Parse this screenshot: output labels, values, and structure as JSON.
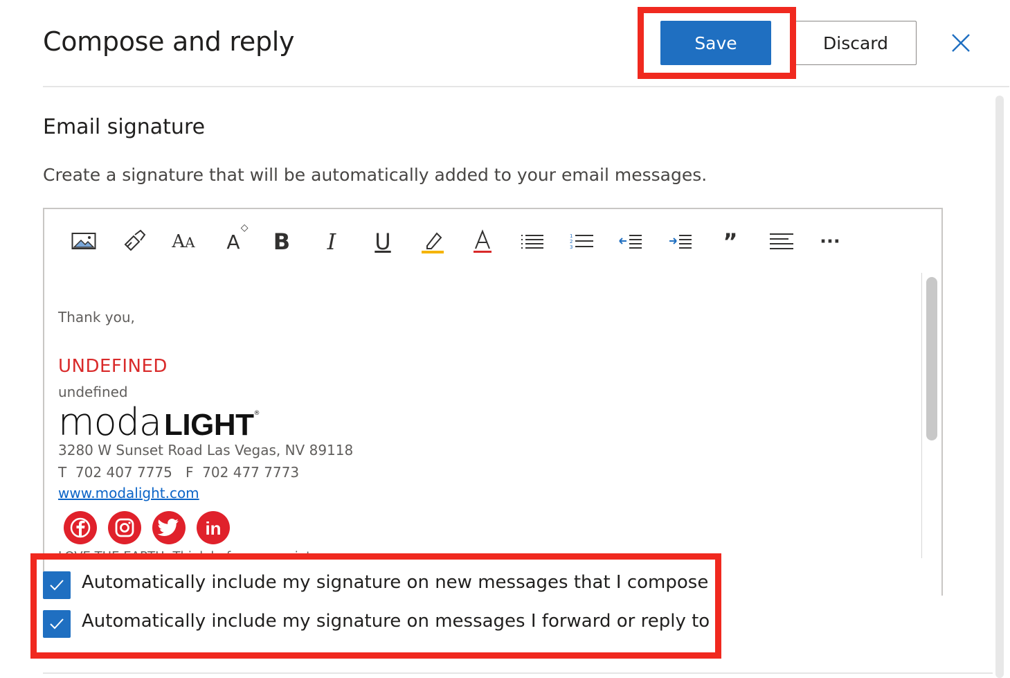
{
  "header": {
    "title": "Compose and reply",
    "save_label": "Save",
    "discard_label": "Discard"
  },
  "section": {
    "title": "Email signature",
    "description": "Create a signature that will be automatically added to your email messages."
  },
  "toolbar": {
    "items": [
      "insert-image-icon",
      "format-painter-icon",
      "font-icon",
      "font-size-icon",
      "bold-icon",
      "italic-icon",
      "underline-icon",
      "highlight-icon",
      "font-color-icon",
      "bullet-list-icon",
      "numbered-list-icon",
      "decrease-indent-icon",
      "increase-indent-icon",
      "quote-icon",
      "align-icon",
      "more-options-icon"
    ],
    "bold_glyph": "B",
    "italic_glyph": "I",
    "underline_glyph": "U",
    "more_glyph": "···",
    "quote_glyph": "”"
  },
  "signature": {
    "greeting": "Thank you,",
    "name": "UNDEFINED",
    "role": "undefined",
    "logo_part1": "moda",
    "logo_part2": "LIGHT",
    "logo_reg": "®",
    "address": "3280 W Sunset Road Las Vegas, NV 89118",
    "phone": "T  702 407 7775   F  702 477 7773",
    "website": "www.modalight.com",
    "social": [
      "facebook-icon",
      "instagram-icon",
      "twitter-icon",
      "linkedin-icon"
    ],
    "linkedin_text": "in",
    "cutoff_line": "LOVE THE EARTH: Think before you print"
  },
  "options": {
    "new_messages_label": "Automatically include my signature on new messages that I compose",
    "new_messages_checked": true,
    "reply_label": "Automatically include my signature on messages I forward or reply to",
    "reply_checked": true
  },
  "colors": {
    "accent": "#1f6fc1",
    "highlight_box": "#f0291f",
    "brand_red": "#e0212b"
  }
}
